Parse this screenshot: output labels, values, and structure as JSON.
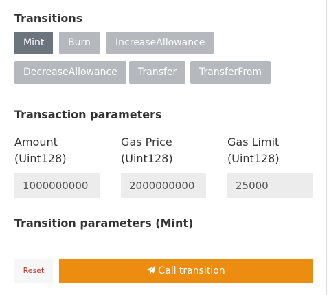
{
  "transitions": {
    "heading": "Transitions",
    "buttons": [
      {
        "label": "Mint",
        "active": true
      },
      {
        "label": "Burn",
        "active": false
      },
      {
        "label": "IncreaseAllowance",
        "active": false
      },
      {
        "label": "DecreaseAllowance",
        "active": false
      },
      {
        "label": "Transfer",
        "active": false
      },
      {
        "label": "TransferFrom",
        "active": false
      }
    ]
  },
  "transaction_params": {
    "heading": "Transaction parameters",
    "fields": [
      {
        "label_line1": "Amount",
        "label_line2": "(Uint128)",
        "value": "1000000000"
      },
      {
        "label_line1": "Gas Price",
        "label_line2": "(Uint128)",
        "value": "2000000000"
      },
      {
        "label_line1": "Gas Limit",
        "label_line2": "(Uint128)",
        "value": "25000"
      }
    ]
  },
  "transition_params": {
    "heading": "Transition parameters (Mint)"
  },
  "actions": {
    "reset_label": "Reset",
    "call_label": "Call transition",
    "call_icon": "paper-plane-icon"
  },
  "colors": {
    "active_button": "#6c757d",
    "inactive_button": "#b5b9bd",
    "call_button": "#ec8c10",
    "reset_text": "#c0392b",
    "input_bg": "#ececec"
  }
}
